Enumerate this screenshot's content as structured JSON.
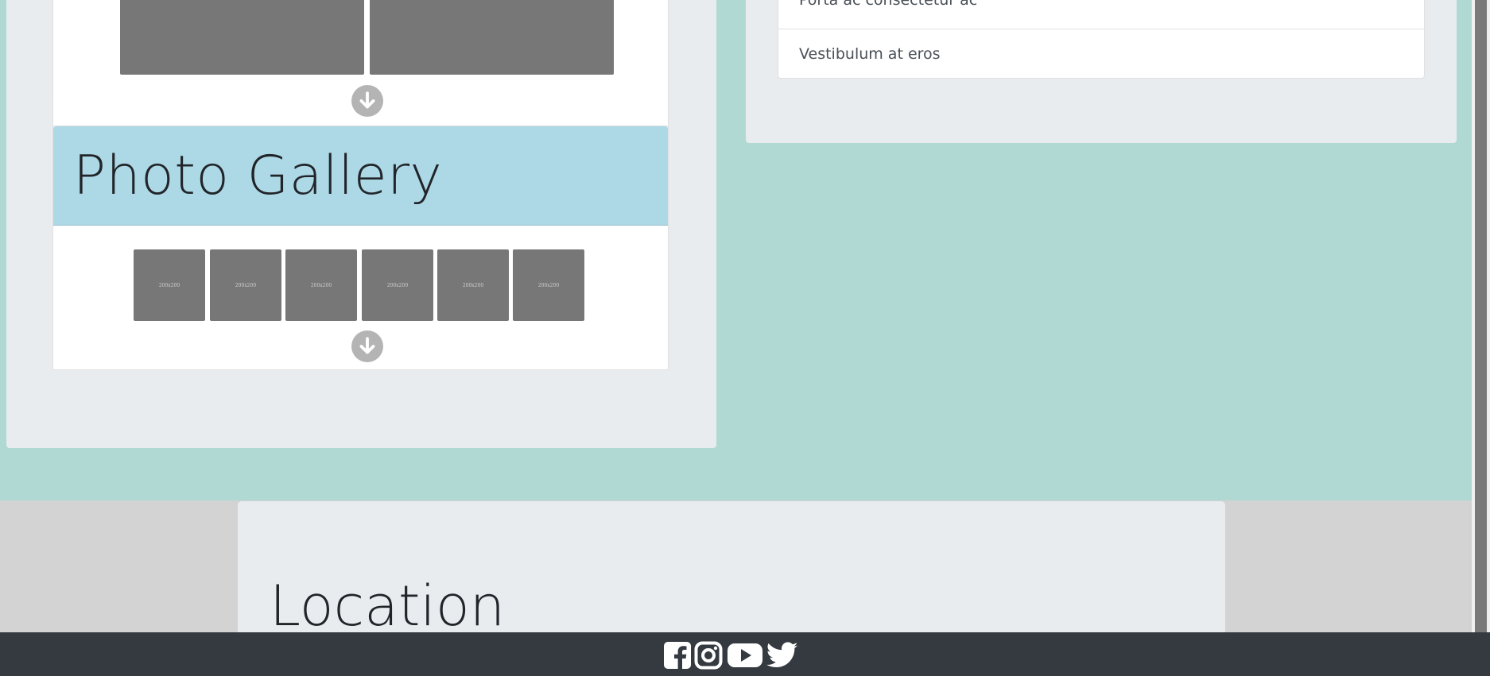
{
  "gallery": {
    "title": "Photo Gallery",
    "thumbs": [
      "200x200",
      "200x200",
      "200x200",
      "200x200",
      "200x200",
      "200x200"
    ]
  },
  "list": {
    "items": [
      "Porta ac consectetur ac",
      "Vestibulum at eros"
    ]
  },
  "location": {
    "title": "Location"
  },
  "icons": {
    "scroll_down": "arrow-down-circle-icon",
    "social": [
      "facebook-icon",
      "instagram-icon",
      "youtube-icon",
      "twitter-icon"
    ]
  },
  "colors": {
    "teal_bg": "#b1d9d4",
    "gallery_header": "#add8e6",
    "footer": "#343a40"
  }
}
